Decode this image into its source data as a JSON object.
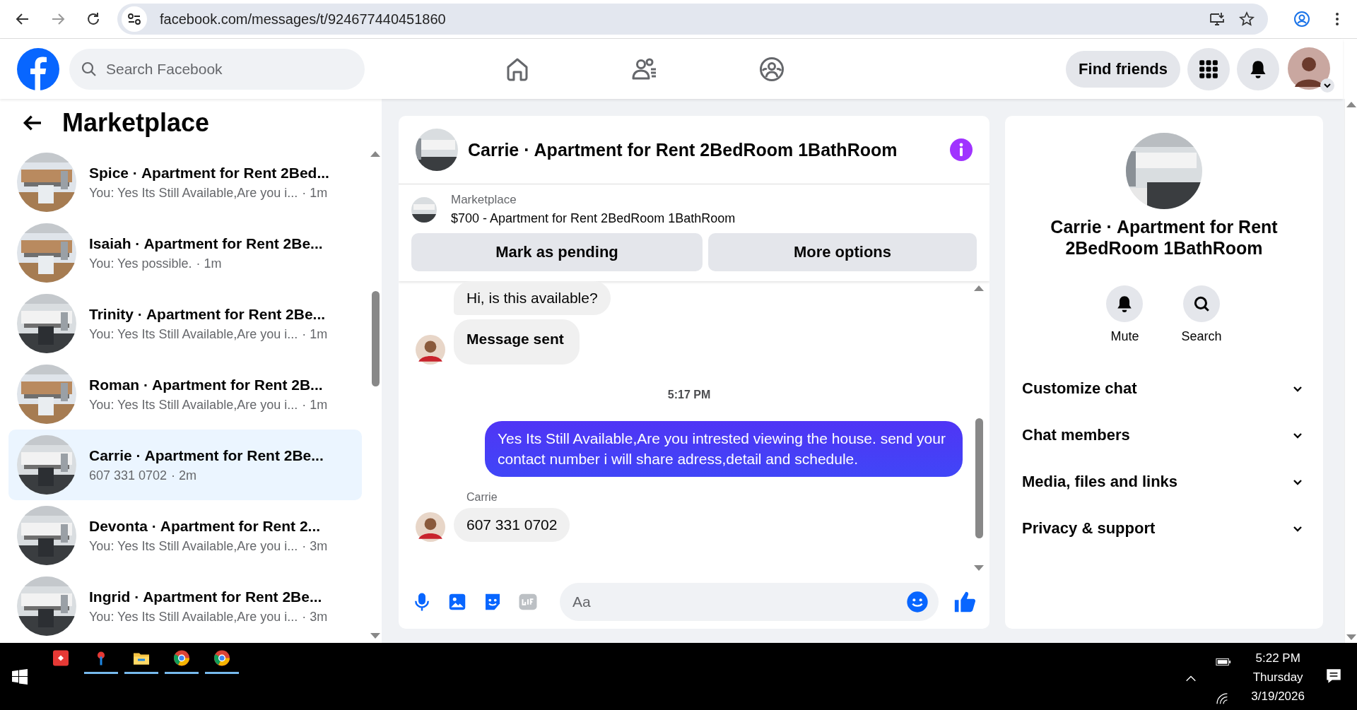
{
  "browser": {
    "url": "facebook.com/messages/t/924677440451860"
  },
  "nav": {
    "search": {
      "placeholder": "Search Facebook"
    },
    "find_friends": "Find friends"
  },
  "sidebar": {
    "title": "Marketplace",
    "conversations": [
      {
        "name": "Spice · Apartment for Rent 2Bed...",
        "preview": "You: Yes Its Still Available,Are you i...",
        "time": "· 1m",
        "selected": false
      },
      {
        "name": "Isaiah · Apartment for Rent 2Be...",
        "preview": "You: Yes possible.",
        "time": "· 1m",
        "selected": false
      },
      {
        "name": "Trinity · Apartment for Rent 2Be...",
        "preview": "You: Yes Its Still Available,Are you i...",
        "time": "· 1m",
        "selected": false
      },
      {
        "name": "Roman · Apartment for Rent 2B...",
        "preview": "You: Yes Its Still Available,Are you i...",
        "time": "· 1m",
        "selected": false
      },
      {
        "name": "Carrie · Apartment for Rent 2Be...",
        "preview": "607 331 0702",
        "time": "· 2m",
        "selected": true
      },
      {
        "name": "Devonta · Apartment for Rent 2...",
        "preview": "You: Yes Its Still Available,Are you i...",
        "time": "· 3m",
        "selected": false
      },
      {
        "name": "Ingrid · Apartment for Rent 2Be...",
        "preview": "You: Yes Its Still Available,Are you i...",
        "time": "· 3m",
        "selected": false
      }
    ]
  },
  "chat": {
    "title": "Carrie · Apartment for Rent 2BedRoom 1BathRoom",
    "listing": {
      "label": "Marketplace",
      "text": "$700 - Apartment for Rent 2BedRoom 1BathRoom",
      "buttons": [
        "Mark as pending",
        "More options"
      ]
    },
    "messages": [
      {
        "kind": "incoming",
        "text": "Hi, is this available?",
        "avatar": false,
        "bold": false
      },
      {
        "kind": "incoming",
        "text": "Message sent",
        "avatar": true,
        "bold": true
      },
      {
        "kind": "time",
        "text": "5:17 PM"
      },
      {
        "kind": "outgoing",
        "text": "Yes Its Still Available,Are you intrested viewing the house. send your contact number i will share adress,detail and schedule."
      },
      {
        "kind": "sender",
        "text": "Carrie"
      },
      {
        "kind": "incoming",
        "text": "607 331 0702",
        "avatar": true,
        "bold": false
      }
    ],
    "composer": {
      "placeholder": "Aa"
    }
  },
  "details": {
    "title": "Carrie · Apartment for Rent 2BedRoom 1BathRoom",
    "actions": [
      {
        "kind": "mute",
        "label": "Mute"
      },
      {
        "kind": "search",
        "label": "Search"
      }
    ],
    "sections": [
      "Customize chat",
      "Chat members",
      "Media, files and links",
      "Privacy & support"
    ]
  },
  "taskbar": {
    "time": "5:22 PM",
    "day": "Thursday",
    "date": "3/19/2026"
  }
}
